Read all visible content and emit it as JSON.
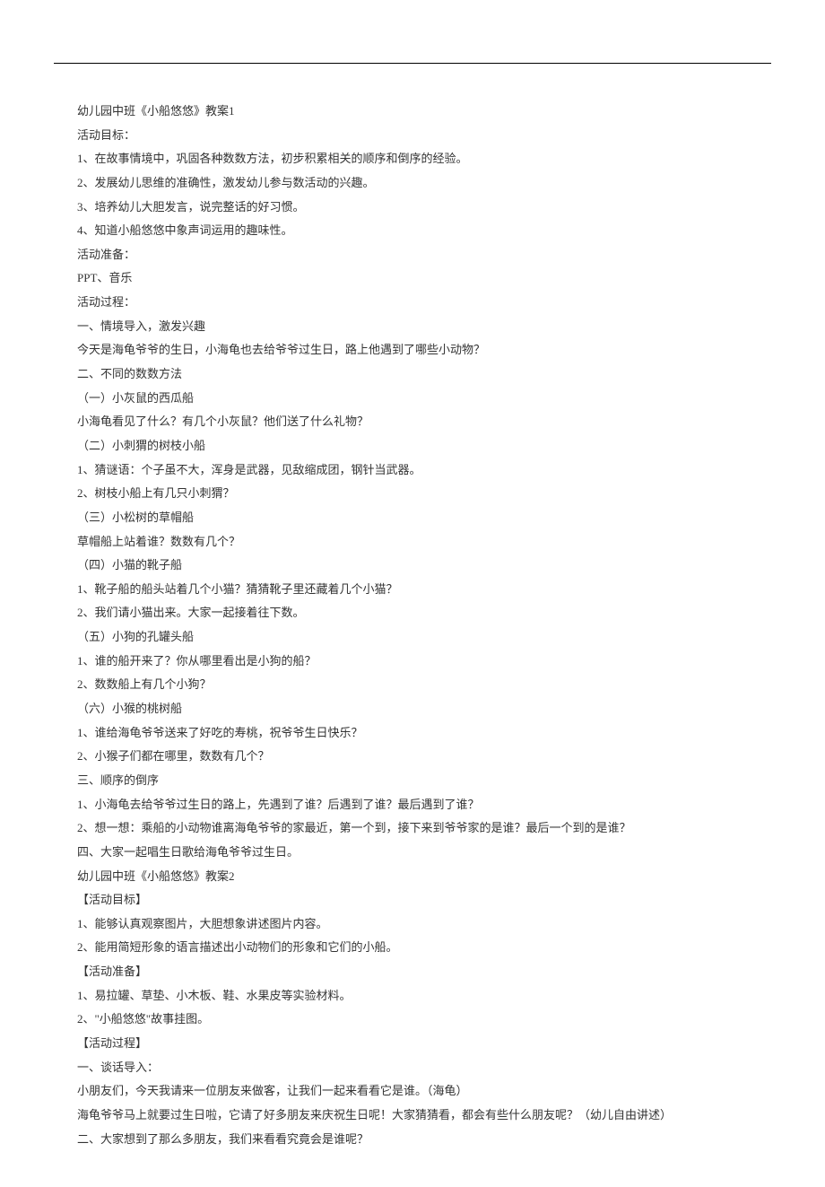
{
  "lines": [
    "幼儿园中班《小船悠悠》教案1",
    "活动目标：",
    "1、在故事情境中，巩固各种数数方法，初步积累相关的顺序和倒序的经验。",
    "2、发展幼儿思维的准确性，激发幼儿参与数活动的兴趣。",
    "3、培养幼儿大胆发言，说完整话的好习惯。",
    "4、知道小船悠悠中象声词运用的趣味性。",
    "活动准备：",
    "PPT、音乐",
    "活动过程：",
    "一、情境导入，激发兴趣",
    "今天是海龟爷爷的生日，小海龟也去给爷爷过生日，路上他遇到了哪些小动物？",
    "二、不同的数数方法",
    "（一）小灰鼠的西瓜船",
    "小海龟看见了什么？有几个小灰鼠？他们送了什么礼物？",
    "（二）小刺猬的树枝小船",
    "1、猜谜语：个子虽不大，浑身是武器，见敌缩成团，钢针当武器。",
    "2、树枝小船上有几只小刺猬？",
    "（三）小松树的草帽船",
    "草帽船上站着谁？数数有几个？",
    "（四）小猫的靴子船",
    "1、靴子船的船头站着几个小猫？猜猜靴子里还藏着几个小猫？",
    "2、我们请小猫出来。大家一起接着往下数。",
    "（五）小狗的孔罐头船",
    "1、谁的船开来了？你从哪里看出是小狗的船？",
    "2、数数船上有几个小狗？",
    "（六）小猴的桃树船",
    "1、谁给海龟爷爷送来了好吃的寿桃，祝爷爷生日快乐？",
    "2、小猴子们都在哪里，数数有几个？",
    "三、顺序的倒序",
    "1、小海龟去给爷爷过生日的路上，先遇到了谁？后遇到了谁？最后遇到了谁？",
    "2、想一想：乘船的小动物谁离海龟爷爷的家最近，第一个到，接下来到爷爷家的是谁？最后一个到的是谁？",
    "四、大家一起唱生日歌给海龟爷爷过生日。",
    "幼儿园中班《小船悠悠》教案2",
    "【活动目标】",
    "1、能够认真观察图片，大胆想象讲述图片内容。",
    "2、能用简短形象的语言描述出小动物们的形象和它们的小船。",
    "【活动准备】",
    "1、易拉罐、草垫、小木板、鞋、水果皮等实验材料。",
    "2、\"小船悠悠\"故事挂图。",
    "【活动过程】",
    "一、谈话导入：",
    "小朋友们，今天我请来一位朋友来做客，让我们一起来看看它是谁。（海龟）",
    "海龟爷爷马上就要过生日啦，它请了好多朋友来庆祝生日呢！大家猜猜看，都会有些什么朋友呢？（幼儿自由讲述）",
    "二、大家想到了那么多朋友，我们来看看究竟会是谁呢？"
  ]
}
